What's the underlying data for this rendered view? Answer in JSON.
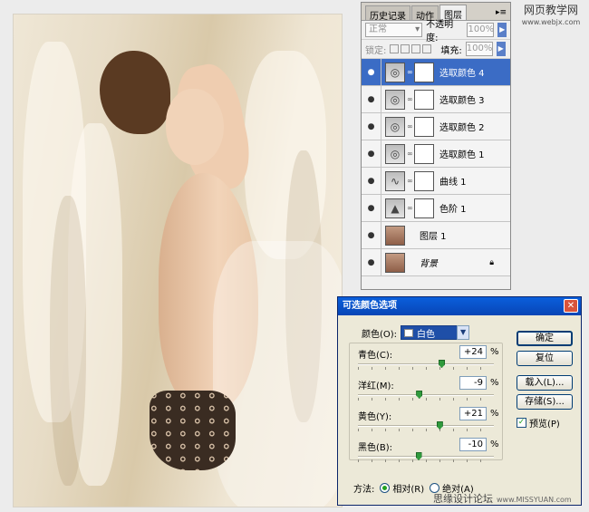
{
  "panel": {
    "tabs": [
      {
        "label": "历史记录"
      },
      {
        "label": "动作"
      },
      {
        "label": "图层"
      }
    ],
    "blend_mode": "正常",
    "opacity_label": "不透明度:",
    "opacity_value": "100%",
    "lock_label": "锁定:",
    "fill_label": "填充:",
    "fill_value": "100%",
    "layers": [
      {
        "name": "选取颜色 4",
        "selected": true,
        "type": "adjustment",
        "icon": "selective-color-icon"
      },
      {
        "name": "选取颜色 3",
        "selected": false,
        "type": "adjustment",
        "icon": "selective-color-icon"
      },
      {
        "name": "选取颜色 2",
        "selected": false,
        "type": "adjustment",
        "icon": "selective-color-icon"
      },
      {
        "name": "选取颜色 1",
        "selected": false,
        "type": "adjustment",
        "icon": "selective-color-icon"
      },
      {
        "name": "曲线 1",
        "selected": false,
        "type": "adjustment",
        "icon": "curves-icon"
      },
      {
        "name": "色阶 1",
        "selected": false,
        "type": "adjustment",
        "icon": "levels-icon"
      },
      {
        "name": "图层 1",
        "selected": false,
        "type": "pixel",
        "icon": "photo-thumb"
      },
      {
        "name": "背景",
        "selected": false,
        "type": "background",
        "icon": "photo-thumb"
      }
    ]
  },
  "dialog": {
    "title": "可选颜色选项",
    "colors_label": "颜色(O):",
    "colors_value": "白色",
    "sliders": [
      {
        "label": "青色(C):",
        "value": "+24",
        "unit": "%",
        "level": 24
      },
      {
        "label": "洋红(M):",
        "value": "-9",
        "unit": "%",
        "level": -9
      },
      {
        "label": "黄色(Y):",
        "value": "+21",
        "unit": "%",
        "level": 21
      },
      {
        "label": "黑色(B):",
        "value": "-10",
        "unit": "%",
        "level": -10
      }
    ],
    "buttons": {
      "ok": "确定",
      "reset": "复位",
      "load": "载入(L)...",
      "save": "存储(S)..."
    },
    "preview_label": "预览(P)",
    "preview_checked": true,
    "method_label": "方法:",
    "method_relative": "相对(R)",
    "method_absolute": "绝对(A)",
    "method_selected": "relative"
  },
  "watermarks": {
    "top_title": "网页教学网",
    "top_url": "www.webjx.com",
    "bottom_title": "思缘设计论坛",
    "bottom_url": "www.MISSYUAN.com"
  },
  "colors": {
    "selection": "#3b6cc5",
    "titlebar": "#0a5fdc",
    "knob": "#2f9a3c"
  }
}
